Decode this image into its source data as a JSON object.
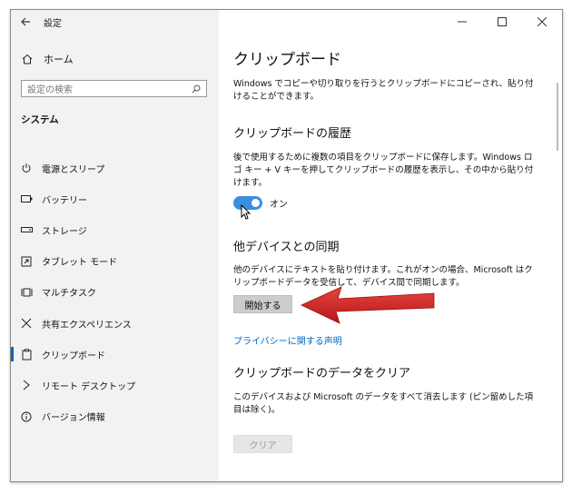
{
  "window": {
    "title": "設定",
    "back_icon": "arrow-left-icon"
  },
  "sidebar": {
    "home_label": "ホーム",
    "search_placeholder": "設定の検索",
    "section_title": "システム",
    "items": [
      {
        "label": "電源とスリープ",
        "icon": "power-icon"
      },
      {
        "label": "バッテリー",
        "icon": "battery-icon"
      },
      {
        "label": "ストレージ",
        "icon": "storage-icon"
      },
      {
        "label": "タブレット モード",
        "icon": "tablet-icon"
      },
      {
        "label": "マルチタスク",
        "icon": "multitask-icon"
      },
      {
        "label": "共有エクスペリエンス",
        "icon": "share-icon"
      },
      {
        "label": "クリップボード",
        "icon": "clipboard-icon",
        "active": true
      },
      {
        "label": "リモート デスクトップ",
        "icon": "remote-desktop-icon"
      },
      {
        "label": "バージョン情報",
        "icon": "info-icon"
      }
    ]
  },
  "main": {
    "title": "クリップボード",
    "intro": "Windows でコピーや切り取りを行うとクリップボードにコピーされ、貼り付けることができます。",
    "history": {
      "heading": "クリップボードの履歴",
      "description": "後で使用するために複数の項目をクリップボードに保存します。Windows ロゴ キー + V キーを押してクリップボードの履歴を表示し、その中から貼り付けます。",
      "toggle_label": "オン",
      "toggle_on": true
    },
    "sync": {
      "heading": "他デバイスとの同期",
      "description": "他のデバイスにテキストを貼り付けます。これがオンの場合、Microsoft はクリップボードデータを受信して、デバイス間で同期します。",
      "button_label": "開始する"
    },
    "privacy_link": "プライバシーに関する声明",
    "clear": {
      "heading": "クリップボードのデータをクリア",
      "description": "このデバイスおよび Microsoft のデータをすべて消去します (ピン留めした項目は除く)。",
      "button_label": "クリア"
    }
  },
  "colors": {
    "accent": "#0067c0",
    "toggle": "#3a8fe0",
    "annotation_arrow": "#d8262c"
  }
}
